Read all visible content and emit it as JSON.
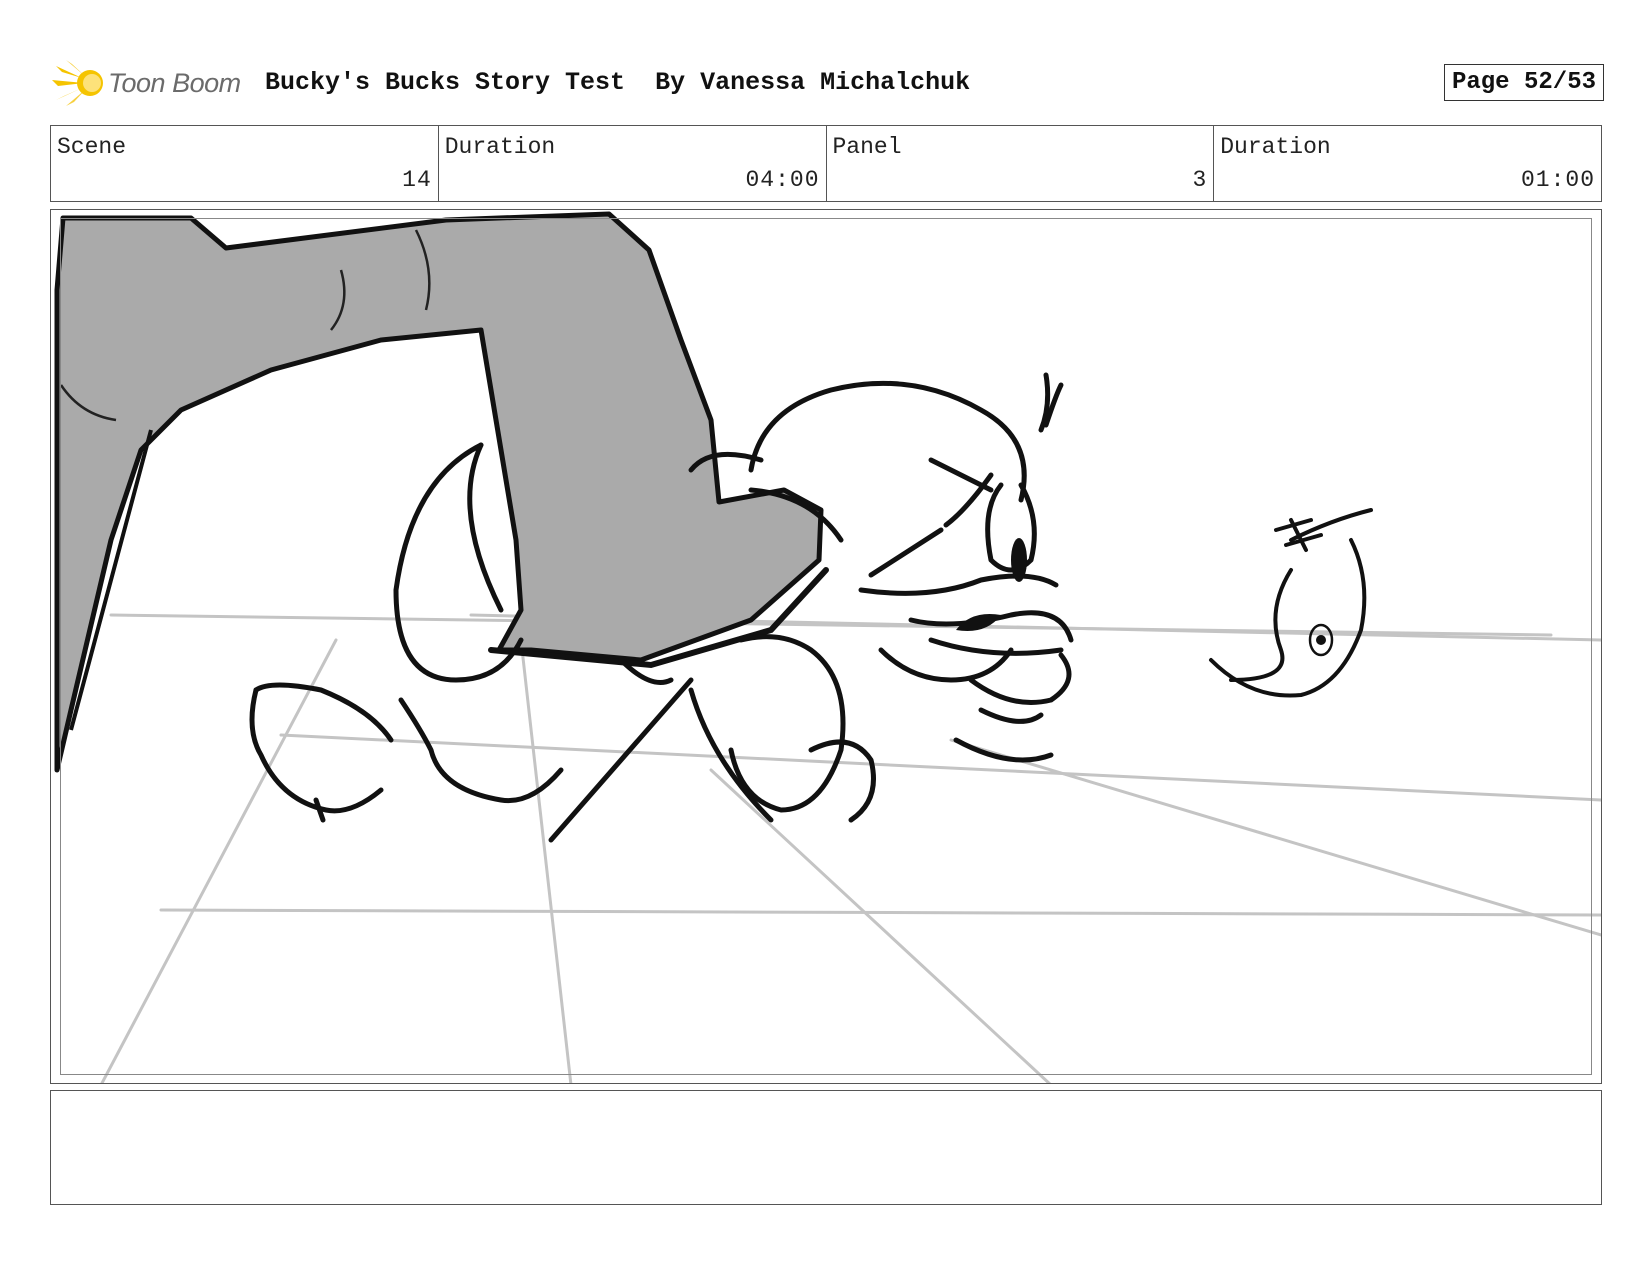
{
  "brand": {
    "logo_text": "Toon Boom",
    "accent": "#f5c400"
  },
  "header": {
    "title": "Bucky's Bucks Story Test  By Vanessa Michalchuk",
    "page": "Page 52/53"
  },
  "info": {
    "scene_label": "Scene",
    "scene_value": "14",
    "scene_duration_label": "Duration",
    "scene_duration_value": "04:00",
    "panel_label": "Panel",
    "panel_value": "3",
    "panel_duration_label": "Duration",
    "panel_duration_value": "01:00"
  },
  "notes": {
    "text": ""
  },
  "icons": {
    "logo": "toon-boom-starburst-icon"
  },
  "colors": {
    "boot_fill": "#aaaaaa",
    "floor_lines": "#c4c4c4",
    "ink": "#111111"
  }
}
